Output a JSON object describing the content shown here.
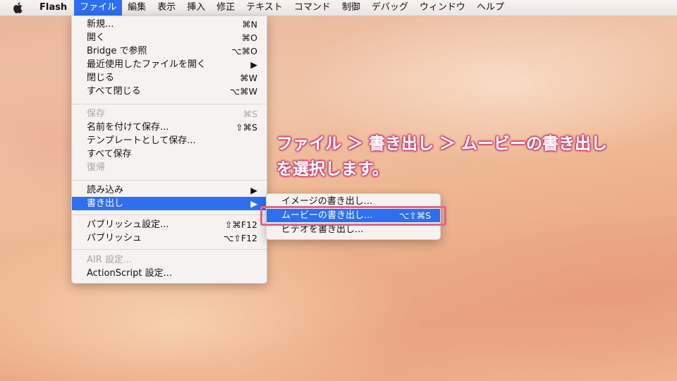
{
  "menubar": {
    "app_name": "Flash",
    "items": [
      "ファイル",
      "編集",
      "表示",
      "挿入",
      "修正",
      "テキスト",
      "コマンド",
      "制御",
      "デバッグ",
      "ウィンドウ",
      "ヘルプ"
    ]
  },
  "file_menu": {
    "items": [
      {
        "label": "新規...",
        "shortcut": "⌘N",
        "disabled": false
      },
      {
        "label": "開く",
        "shortcut": "⌘O",
        "disabled": false
      },
      {
        "label": "Bridge で参照",
        "shortcut": "⌥⌘O",
        "disabled": false
      },
      {
        "label": "最近使用したファイルを開く",
        "shortcut": "▶",
        "disabled": false
      },
      {
        "label": "閉じる",
        "shortcut": "⌘W",
        "disabled": false
      },
      {
        "label": "すべて閉じる",
        "shortcut": "⌥⌘W",
        "disabled": false
      },
      {
        "label": "保存",
        "shortcut": "⌘S",
        "disabled": true
      },
      {
        "label": "名前を付けて保存...",
        "shortcut": "⇧⌘S",
        "disabled": false
      },
      {
        "label": "テンプレートとして保存...",
        "shortcut": "",
        "disabled": false
      },
      {
        "label": "すべて保存",
        "shortcut": "",
        "disabled": false
      },
      {
        "label": "復帰",
        "shortcut": "",
        "disabled": true
      },
      {
        "label": "読み込み",
        "shortcut": "▶",
        "disabled": false
      },
      {
        "label": "書き出し",
        "shortcut": "▶",
        "disabled": false
      },
      {
        "label": "パブリッシュ設定...",
        "shortcut": "⇧⌘F12",
        "disabled": false
      },
      {
        "label": "パブリッシュ",
        "shortcut": "⌥⇧F12",
        "disabled": false
      },
      {
        "label": "AIR 設定...",
        "shortcut": "",
        "disabled": true
      },
      {
        "label": "ActionScript 設定...",
        "shortcut": "",
        "disabled": false
      }
    ]
  },
  "export_submenu": {
    "items": [
      {
        "label": "イメージの書き出し...",
        "shortcut": ""
      },
      {
        "label": "ムービーの書き出し...",
        "shortcut": "⌥⇧⌘S"
      },
      {
        "label": "ビデオを書き出し...",
        "shortcut": ""
      }
    ]
  },
  "annotation": {
    "line1": "ファイル ＞ 書き出し ＞ ムービーの書き出し",
    "line2": "を選択します。",
    "color": "#e0648e"
  }
}
